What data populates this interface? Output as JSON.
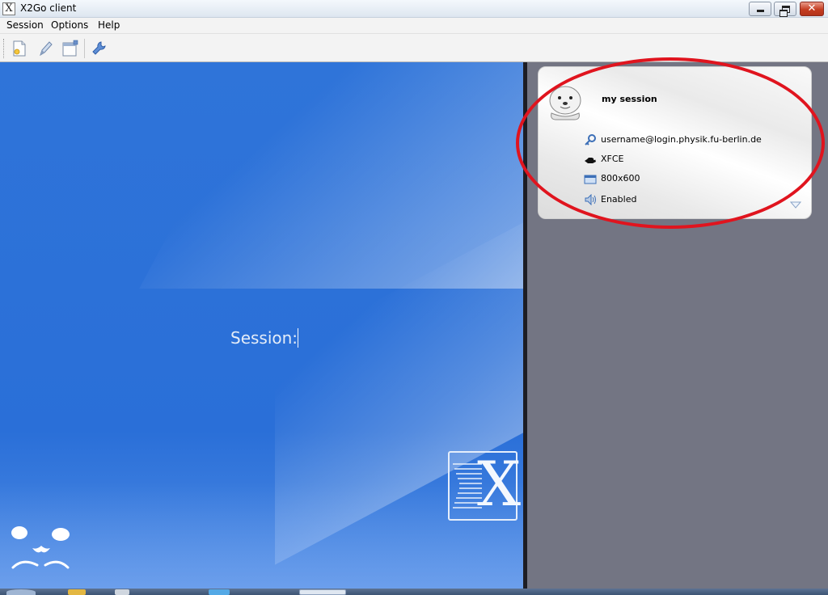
{
  "window": {
    "title": "X2Go client",
    "app_icon": "X",
    "close_glyph": "✕"
  },
  "menu": {
    "items": [
      {
        "label": "Session"
      },
      {
        "label": "Options"
      },
      {
        "label": "Help"
      }
    ]
  },
  "toolbar": {
    "buttons": [
      "new-session-icon",
      "edit-session-icon",
      "session-settings-icon",
      "preferences-wrench-icon"
    ]
  },
  "login": {
    "session_label": "Session:"
  },
  "logo": {
    "x_letter": "X"
  },
  "session_card": {
    "name": "my session",
    "user_host": "username@login.physik.fu-berlin.de",
    "desktop": "XFCE",
    "resolution": "800x600",
    "sound": "Enabled"
  },
  "colors": {
    "accent_blue": "#2a6fd8",
    "panel_gray": "#737583",
    "highlight_red": "#e0141e"
  }
}
